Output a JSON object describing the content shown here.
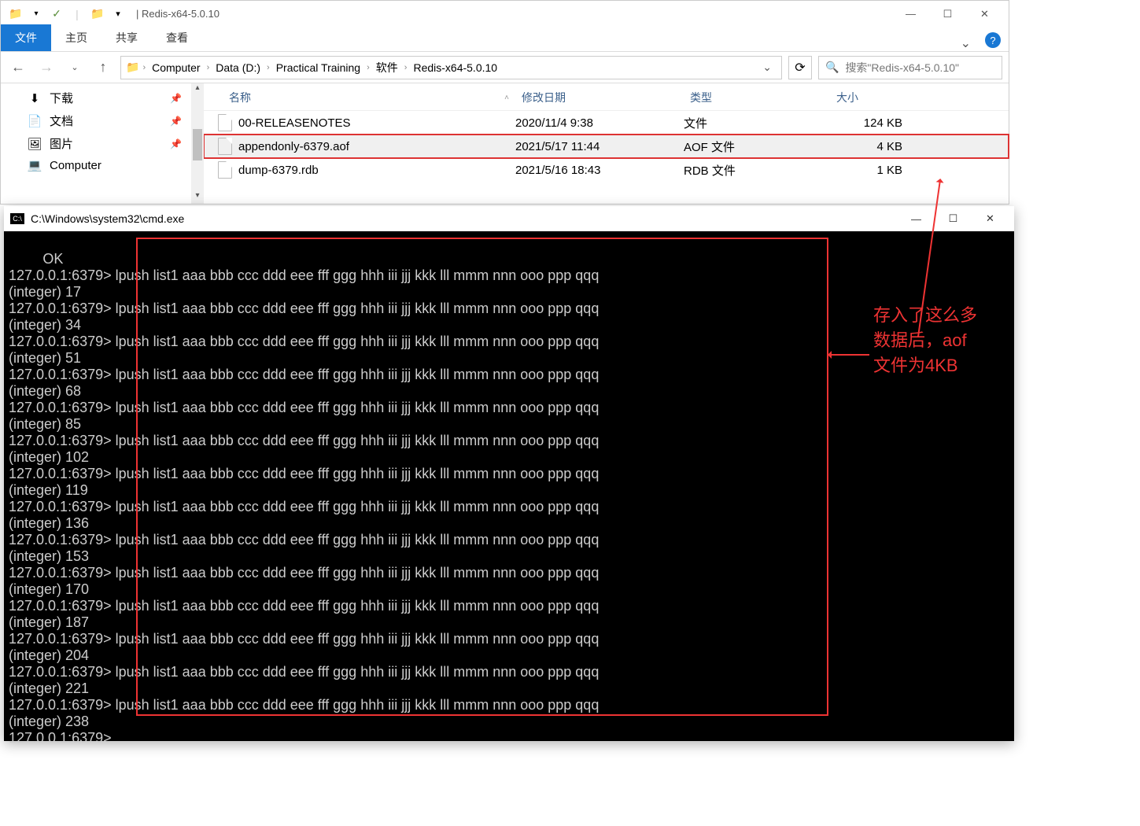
{
  "explorer": {
    "title": "| Redis-x64-5.0.10",
    "tabs": {
      "file": "文件",
      "home": "主页",
      "share": "共享",
      "view": "查看"
    },
    "breadcrumbs": [
      "Computer",
      "Data (D:)",
      "Practical Training",
      "软件",
      "Redis-x64-5.0.10"
    ],
    "search_placeholder": "搜索\"Redis-x64-5.0.10\"",
    "sidebar": [
      {
        "icon": "⬇",
        "label": "下载",
        "pinned": true
      },
      {
        "icon": "📄",
        "label": "文档",
        "pinned": true
      },
      {
        "icon": "🖼",
        "label": "图片",
        "pinned": true
      },
      {
        "icon": "💻",
        "label": "Computer",
        "pinned": false
      }
    ],
    "columns": {
      "name": "名称",
      "date": "修改日期",
      "type": "类型",
      "size": "大小"
    },
    "files": [
      {
        "name": "00-RELEASENOTES",
        "date": "2020/11/4 9:38",
        "type": "文件",
        "size": "124 KB",
        "hl": false
      },
      {
        "name": "appendonly-6379.aof",
        "date": "2021/5/17 11:44",
        "type": "AOF 文件",
        "size": "4 KB",
        "hl": true
      },
      {
        "name": "dump-6379.rdb",
        "date": "2021/5/16 18:43",
        "type": "RDB 文件",
        "size": "1 KB",
        "hl": false
      }
    ]
  },
  "cmd": {
    "title": "C:\\Windows\\system32\\cmd.exe",
    "prompt": "127.0.0.1:6379>",
    "command": "lpush list1 aaa bbb ccc ddd eee fff ggg hhh iii jjj kkk lll mmm nnn ooo ppp qqq",
    "ok": "OK",
    "results": [
      17,
      34,
      51,
      68,
      85,
      102,
      119,
      136,
      153,
      170,
      187,
      204,
      221,
      238
    ]
  },
  "annotation": "存入了这么多\n数据后，aof\n文件为4KB"
}
